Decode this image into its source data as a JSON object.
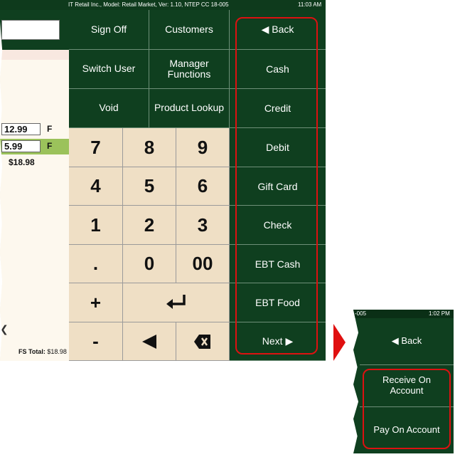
{
  "window": {
    "title": "IT Retail Inc., Model: Retail Market, Ver: 1.10, NTEP CC 18-005",
    "time": "11:03 AM"
  },
  "ticket": {
    "items": [
      {
        "price": "12.99",
        "flag": "F"
      },
      {
        "price": "5.99",
        "flag": "F"
      }
    ],
    "subtotal": "$18.98",
    "fs_total_label": "FS Total:",
    "fs_total_value": "$18.98"
  },
  "function_buttons": {
    "sign_off": "Sign Off",
    "customers": "Customers",
    "switch_user": "Switch User",
    "manager_functions": "Manager Functions",
    "void": "Void",
    "product_lookup": "Product Lookup"
  },
  "keypad": {
    "k7": "7",
    "k8": "8",
    "k9": "9",
    "k4": "4",
    "k5": "5",
    "k6": "6",
    "k1": "1",
    "k2": "2",
    "k3": "3",
    "dot": ".",
    "k0": "0",
    "k00": "00",
    "plus": "+",
    "minus": "-"
  },
  "tenders": {
    "back": "◀ Back",
    "cash": "Cash",
    "credit": "Credit",
    "debit": "Debit",
    "gift_card": "Gift Card",
    "check": "Check",
    "ebt_cash": "EBT Cash",
    "ebt_food": "EBT Food",
    "next": "Next ▶"
  },
  "panel2": {
    "title_fragment": "-005",
    "time": "1:02 PM",
    "back": "◀ Back",
    "receive_on_account": "Receive On Account",
    "pay_on_account": "Pay On Account"
  },
  "colors": {
    "dark_green": "#0f3f1f",
    "keypad_beige": "#efdfc5",
    "highlight_green": "#9bc25b",
    "callout_red": "#d11111"
  },
  "icons": [
    "enter-icon",
    "left-arrow-icon",
    "backspace-icon",
    "right-arrow-icon"
  ]
}
